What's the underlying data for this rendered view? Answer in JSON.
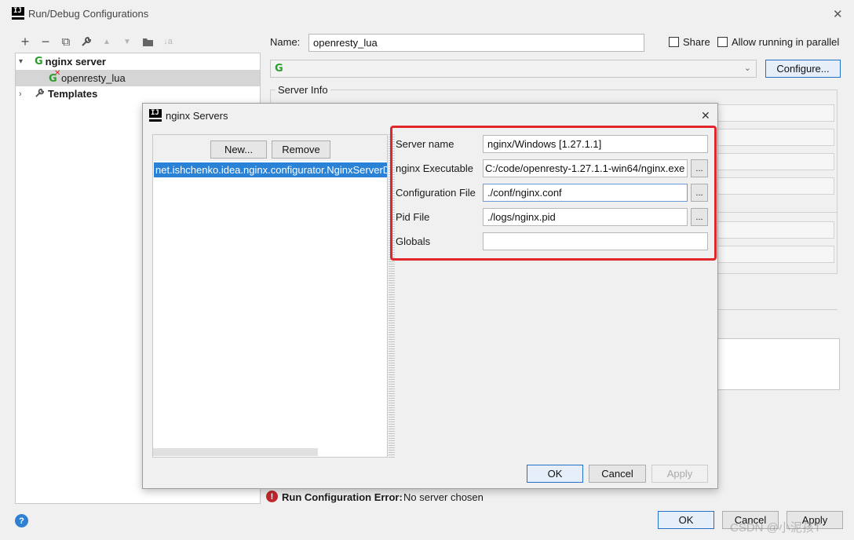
{
  "window": {
    "title": "Run/Debug Configurations",
    "close_glyph": "✕"
  },
  "toolbar": {
    "add": "+",
    "remove": "−",
    "copy": "⧉",
    "wrench": "🔧",
    "up": "▲",
    "down": "▼",
    "folder": "📁",
    "sort": "↓a"
  },
  "tree": {
    "group_label": "nginx server",
    "child_label": "openresty_lua",
    "templates_label": "Templates"
  },
  "config": {
    "name_label": "Name:",
    "name_value": "openresty_lua",
    "share_label": "Share",
    "parallel_label": "Allow running in parallel",
    "server_select_value": "",
    "configure_button": "Configure...",
    "server_info_label": "Server Info"
  },
  "error": {
    "title": "Run Configuration Error:",
    "message": "No server chosen"
  },
  "footer": {
    "ok": "OK",
    "cancel": "Cancel",
    "apply": "Apply",
    "help": "?"
  },
  "dialog": {
    "title": "nginx Servers",
    "close_glyph": "✕",
    "new_button": "New...",
    "remove_button": "Remove",
    "list_items": [
      "net.ishchenko.idea.nginx.configurator.NginxServerD"
    ],
    "fields": {
      "server_name_label": "Server name",
      "server_name_value": "nginx/Windows [1.27.1.1]",
      "executable_label": "nginx Executable",
      "executable_value": "C:/code/openresty-1.27.1.1-win64/nginx.exe",
      "config_file_label": "Configuration File",
      "config_file_value": "./conf/nginx.conf",
      "pid_file_label": "Pid File",
      "pid_file_value": "./logs/nginx.pid",
      "globals_label": "Globals",
      "globals_value": ""
    },
    "browse_label": "...",
    "ok": "OK",
    "cancel": "Cancel",
    "apply": "Apply"
  },
  "watermark": "CSDN @小泥孩T",
  "colors": {
    "selection": "#2a82d6",
    "highlight_frame": "#e0272b",
    "run_icon_green": "#2a9d2a",
    "error_red": "#c0282d"
  }
}
